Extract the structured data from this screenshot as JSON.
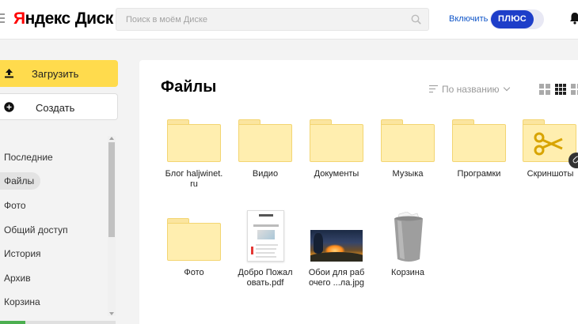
{
  "app": {
    "logo_y": "Я",
    "logo_rest": "ндекс",
    "logo_disk": "Диск"
  },
  "search": {
    "placeholder": "Поиск в моём Диске"
  },
  "promo": {
    "enable_label": "Включить",
    "plus_label": "ПЛЮС"
  },
  "sidebar": {
    "upload_label": "Загрузить",
    "create_label": "Создать",
    "items": [
      {
        "label": "Последние",
        "active": false
      },
      {
        "label": "Файлы",
        "active": true
      },
      {
        "label": "Фото",
        "active": false
      },
      {
        "label": "Общий доступ",
        "active": false
      },
      {
        "label": "История",
        "active": false
      },
      {
        "label": "Архив",
        "active": false
      },
      {
        "label": "Корзина",
        "active": false
      }
    ]
  },
  "main": {
    "title": "Файлы",
    "sort_label": "По названию",
    "files": [
      {
        "name": "Блог haljwinet.\nru",
        "kind": "folder-icon"
      },
      {
        "name": "Видио",
        "kind": "folder-icon"
      },
      {
        "name": "Документы",
        "kind": "folder-icon"
      },
      {
        "name": "Музыка",
        "kind": "folder-icon"
      },
      {
        "name": "Програмки",
        "kind": "folder-icon"
      },
      {
        "name": "Скриншоты",
        "kind": "scissors-folder-icon"
      },
      {
        "name": "Фото",
        "kind": "folder-icon"
      },
      {
        "name": "Добро Пожал\nовать.pdf",
        "kind": "pdf-thumbnail"
      },
      {
        "name": "Обои для раб\nочего ...ла.jpg",
        "kind": "image-thumbnail"
      },
      {
        "name": "Корзина",
        "kind": "trash-icon"
      }
    ]
  },
  "colors": {
    "accent_yellow": "#ffdb4d",
    "plus_blue": "#1e3ec9",
    "link_blue": "#0f55c8",
    "folder": "#ffeeaf"
  }
}
